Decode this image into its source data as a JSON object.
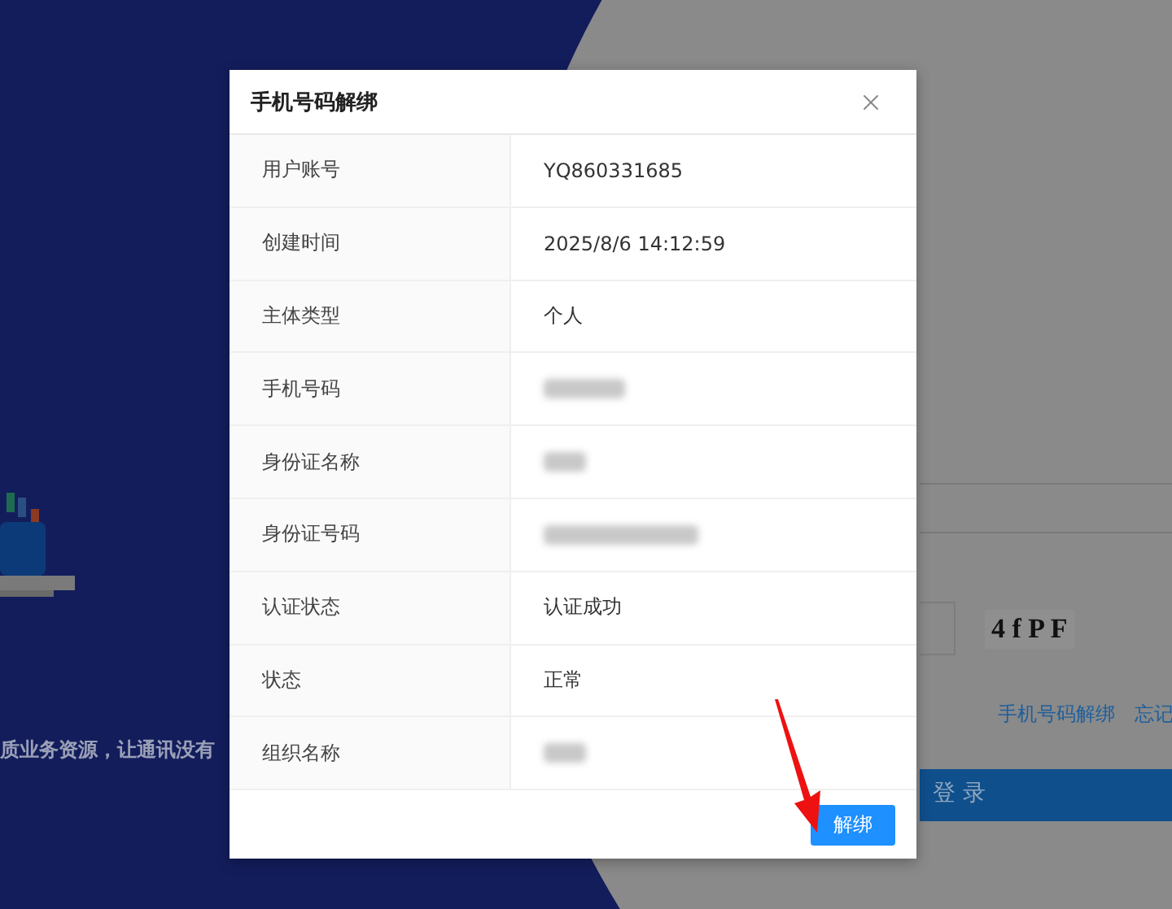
{
  "background": {
    "slogan": "质业务资源，让通讯没有",
    "captcha": "4 f P F",
    "links": [
      "手机号码解绑",
      "忘记"
    ],
    "login_button": "登 录"
  },
  "dialog": {
    "title": "手机号码解绑",
    "rows": [
      {
        "label": "用户账号",
        "kind": "text",
        "value": "YQ860331685"
      },
      {
        "label": "创建时间",
        "kind": "text",
        "value": "2025/8/6 14:12:59"
      },
      {
        "label": "主体类型",
        "kind": "text",
        "value": "个人"
      },
      {
        "label": "手机号码",
        "kind": "redacted"
      },
      {
        "label": "身份证名称",
        "kind": "redacted"
      },
      {
        "label": "身份证号码",
        "kind": "redacted"
      },
      {
        "label": "认证状态",
        "kind": "text",
        "value": "认证成功"
      },
      {
        "label": "状态",
        "kind": "text",
        "value": "正常"
      },
      {
        "label": "组织名称",
        "kind": "redacted"
      }
    ],
    "button": "解绑"
  }
}
